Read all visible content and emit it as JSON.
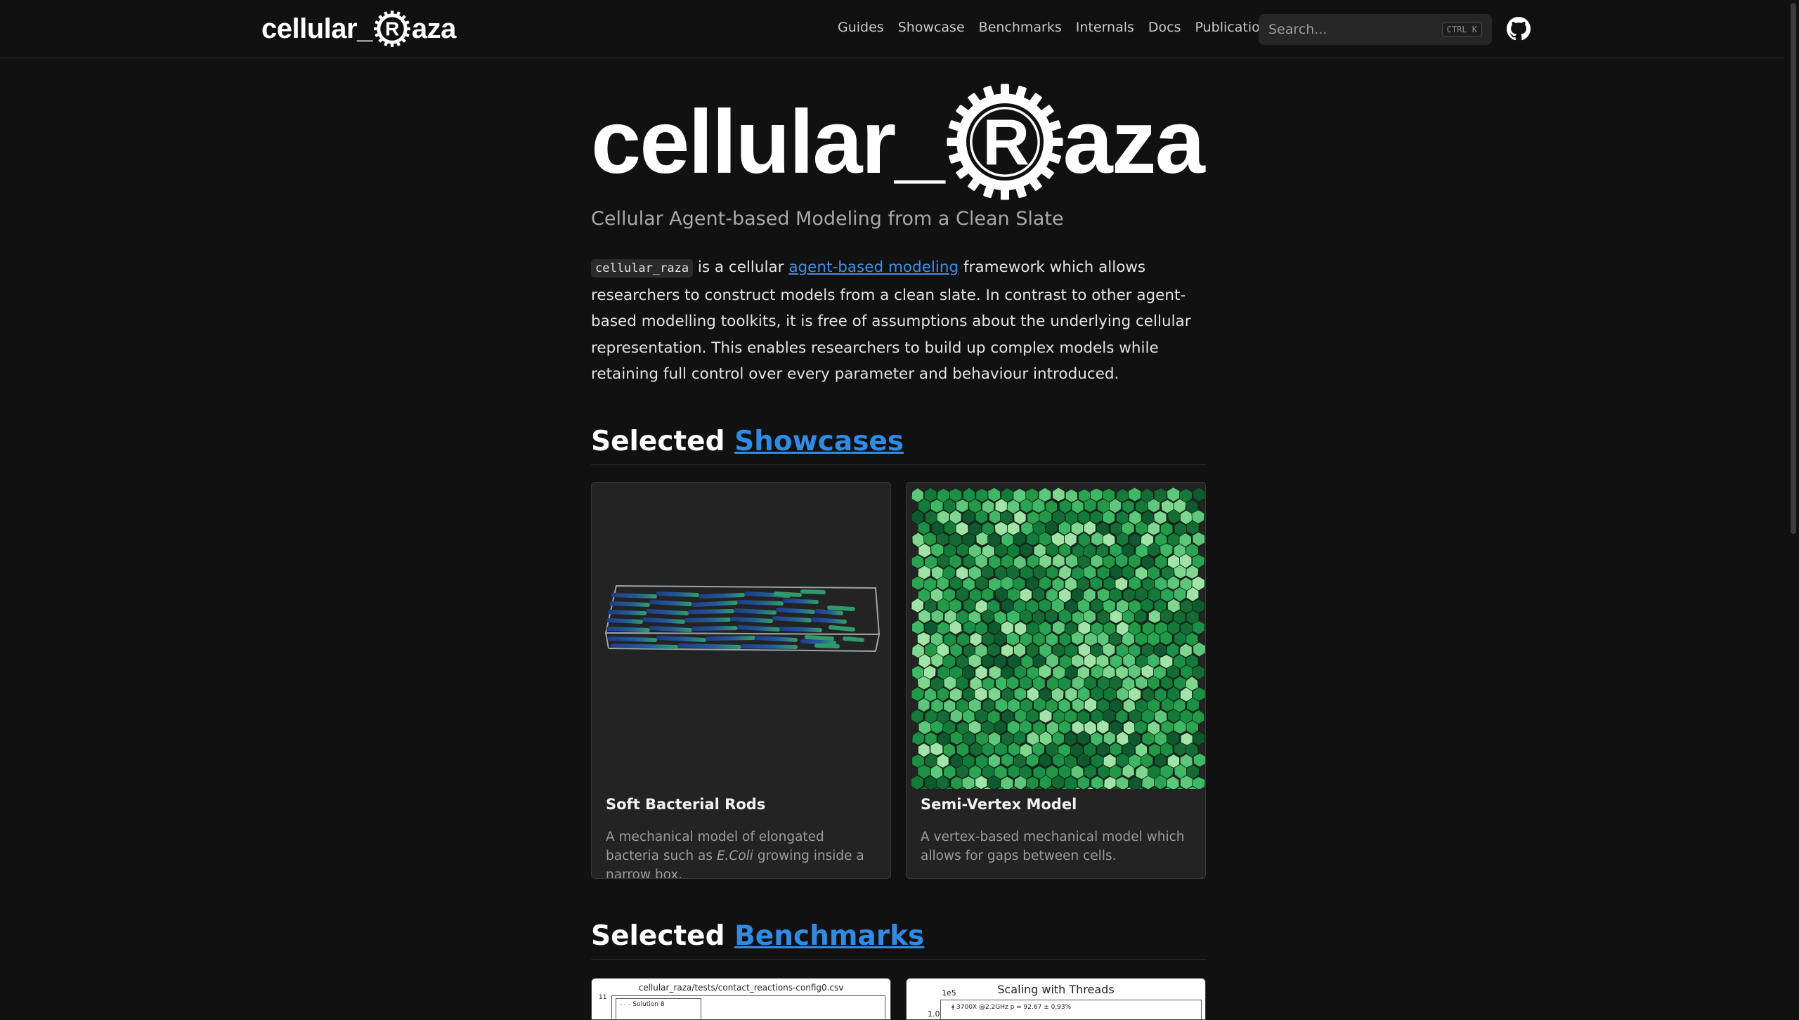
{
  "nav": {
    "logo_left": "cellular_",
    "logo_right": "aza",
    "links": [
      "Guides",
      "Showcase",
      "Benchmarks",
      "Internals",
      "Docs",
      "Publications"
    ],
    "search_placeholder": "Search...",
    "search_shortcut": "CTRL K",
    "github_icon": "github-icon"
  },
  "hero": {
    "title_left": "cellular_",
    "title_right": "aza",
    "subtitle": "Cellular Agent-based Modeling from a Clean Slate"
  },
  "intro": {
    "code": "cellular_raza",
    "text_1": " is a cellular ",
    "link": "agent-based modeling",
    "text_2": " framework which allows researchers to construct models from a clean slate. In contrast to other agent-based modelling toolkits, it is free of assumptions about the underlying cellular representation. This enables researchers to build up complex models while retaining full control over every parameter and behaviour introduced."
  },
  "showcases": {
    "prefix": "Selected ",
    "link": "Showcases",
    "cards": [
      {
        "title": "Soft Bacterial Rods",
        "desc_1": "A mechanical model of elongated bacteria such as ",
        "desc_em": "E.Coli",
        "desc_2": " growing inside a narrow box."
      },
      {
        "title": "Semi-Vertex Model",
        "desc": "A vertex-based mechanical model which allows for gaps between cells."
      }
    ]
  },
  "benchmarks": {
    "prefix": "Selected ",
    "link": "Benchmarks",
    "cards": [
      {
        "title": "cellular_raza/tests/contact_reactions-config0.csv",
        "tick": "11",
        "legend": "Solution 8"
      },
      {
        "title": "Scaling with Threads",
        "exponent": "1e5",
        "tick": "1.0",
        "legend": "3700X @2.2GHz p = 92.67 ± 0.93%"
      }
    ]
  },
  "colors": {
    "background": "#111111",
    "accent": "#2f8be6",
    "card": "#232323"
  }
}
